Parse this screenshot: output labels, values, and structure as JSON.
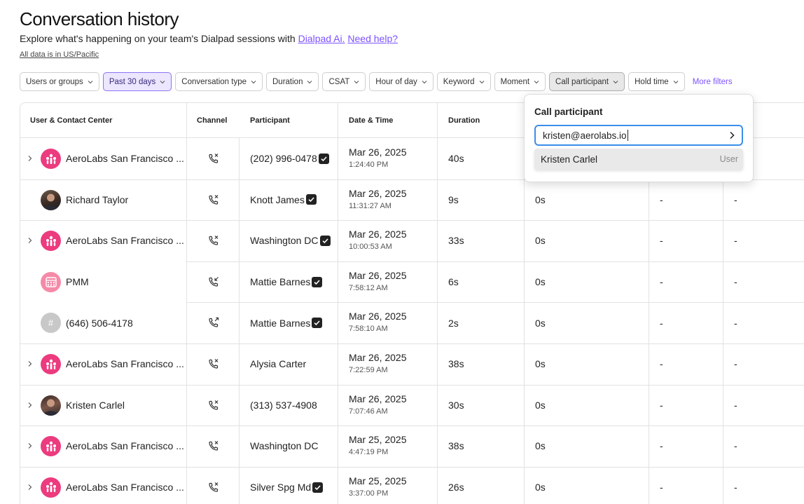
{
  "page": {
    "title": "Conversation history",
    "subtitle_prefix": "Explore what's happening on your team's Dialpad sessions with",
    "link_ai": "Dialpad Ai.",
    "link_help": "Need help?",
    "timezone_note": "All data is in US/Pacific"
  },
  "filters": [
    {
      "label": "Users or groups",
      "state": "default"
    },
    {
      "label": "Past 30 days",
      "state": "selected"
    },
    {
      "label": "Conversation type",
      "state": "default"
    },
    {
      "label": "Duration",
      "state": "default"
    },
    {
      "label": "CSAT",
      "state": "default"
    },
    {
      "label": "Hour of day",
      "state": "default"
    },
    {
      "label": "Keyword",
      "state": "default"
    },
    {
      "label": "Moment",
      "state": "default"
    },
    {
      "label": "Call participant",
      "state": "open"
    },
    {
      "label": "Hold time",
      "state": "default"
    }
  ],
  "more_filters": "More filters",
  "columns": {
    "user": "User & Contact Center",
    "channel": "Channel",
    "participant": "Participant",
    "datetime": "Date & Time",
    "duration": "Duration"
  },
  "rows": [
    {
      "user": "AeroLabs San Francisco ...",
      "avatar": "contact-center-icon",
      "expandable": true,
      "channel": "missed-call-icon",
      "participant": "(202) 996-0478",
      "verified": true,
      "date": "Mar 26, 2025",
      "time": "1:24:40 PM",
      "duration": "40s",
      "col5": "",
      "col6": "",
      "col7": ""
    },
    {
      "user": "Richard Taylor",
      "avatar": "photo",
      "expandable": false,
      "channel": "missed-call-icon",
      "participant": "Knott James",
      "verified": true,
      "date": "Mar 26, 2025",
      "time": "11:31:27 AM",
      "duration": "9s",
      "col5": "0s",
      "col6": "-",
      "col7": "-"
    },
    {
      "user": "AeroLabs San Francisco ...",
      "avatar": "contact-center-icon",
      "expandable": true,
      "channel": "missed-call-icon",
      "participant": "Washington DC",
      "verified": true,
      "date": "Mar 26, 2025",
      "time": "10:00:53 AM",
      "duration": "33s",
      "col5": "0s",
      "col6": "-",
      "col7": "-"
    },
    {
      "user": "PMM",
      "avatar": "calendar-icon",
      "expandable": false,
      "channel": "incoming-call-icon",
      "participant": "Mattie Barnes",
      "verified": true,
      "date": "Mar 26, 2025",
      "time": "7:58:12 AM",
      "duration": "6s",
      "col5": "0s",
      "col6": "-",
      "col7": "-"
    },
    {
      "user": "(646) 506-4178",
      "avatar": "hash-icon",
      "expandable": false,
      "channel": "outgoing-call-icon",
      "participant": "Mattie Barnes",
      "verified": true,
      "date": "Mar 26, 2025",
      "time": "7:58:10 AM",
      "duration": "2s",
      "col5": "0s",
      "col6": "-",
      "col7": "-"
    },
    {
      "user": "AeroLabs San Francisco ...",
      "avatar": "contact-center-icon",
      "expandable": true,
      "channel": "missed-call-icon",
      "participant": "Alysia Carter",
      "verified": false,
      "date": "Mar 26, 2025",
      "time": "7:22:59 AM",
      "duration": "38s",
      "col5": "0s",
      "col6": "-",
      "col7": "-"
    },
    {
      "user": "Kristen Carlel",
      "avatar": "photo",
      "expandable": true,
      "channel": "missed-call-icon",
      "participant": "(313) 537-4908",
      "verified": false,
      "date": "Mar 26, 2025",
      "time": "7:07:46 AM",
      "duration": "30s",
      "col5": "0s",
      "col6": "-",
      "col7": "-"
    },
    {
      "user": "AeroLabs San Francisco ...",
      "avatar": "contact-center-icon",
      "expandable": true,
      "channel": "missed-call-icon",
      "participant": "Washington DC",
      "verified": false,
      "date": "Mar 25, 2025",
      "time": "4:47:19 PM",
      "duration": "38s",
      "col5": "0s",
      "col6": "-",
      "col7": "-"
    },
    {
      "user": "AeroLabs San Francisco ...",
      "avatar": "contact-center-icon",
      "expandable": true,
      "channel": "missed-call-icon",
      "participant": "Silver Spg Md",
      "verified": true,
      "date": "Mar 25, 2025",
      "time": "3:37:00 PM",
      "duration": "26s",
      "col5": "0s",
      "col6": "-",
      "col7": "-"
    }
  ],
  "popover": {
    "title": "Call participant",
    "input_value": "kristen@aerolabs.io",
    "option_name": "Kristen Carlel",
    "option_tag": "User"
  },
  "colors": {
    "accent": "#7c52ff",
    "brand_pink": "#ec3b7e",
    "focus_blue": "#3b8ee8"
  }
}
